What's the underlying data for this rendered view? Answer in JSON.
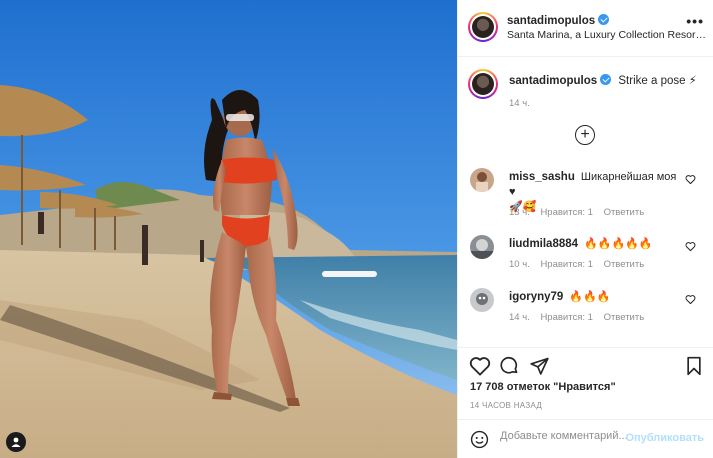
{
  "post": {
    "author": "santadimopulos",
    "verified": true,
    "location": "Santa Marina, a Luxury Collection Resort, Myk...",
    "caption": "Strike a pose ⚡",
    "caption_time": "14 ч.",
    "likes": "17 708 отметок \"Нравится\"",
    "posted_ago": "14 ЧАСОВ НАЗАД"
  },
  "comments": [
    {
      "user": "miss_sashu",
      "text": "Шикарнейшая моя ♥",
      "text2": "🚀🥰",
      "time": "13 ч.",
      "likes": "Нравится: 1",
      "reply": "Ответить"
    },
    {
      "user": "liudmila8884",
      "text": "🔥🔥🔥🔥🔥",
      "time": "10 ч.",
      "likes": "Нравится: 1",
      "reply": "Ответить"
    },
    {
      "user": "igoryny79",
      "text": "🔥🔥🔥",
      "time": "14 ч.",
      "likes": "Нравится: 1",
      "reply": "Ответить"
    }
  ],
  "composer": {
    "placeholder": "Добавьте комментарий...",
    "post_label": "Опубликовать"
  },
  "icons": [
    "more-options-icon",
    "load-more-icon",
    "heart-icon",
    "comment-icon",
    "share-icon",
    "bookmark-icon",
    "emoji-icon",
    "user-tag-icon"
  ],
  "colors": {
    "accent": "#3897f0",
    "post_button_disabled": "#b2dffc",
    "muted": "#8e8e8e"
  }
}
